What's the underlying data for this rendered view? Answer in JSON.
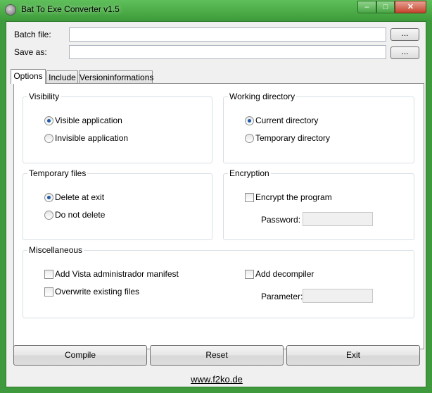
{
  "window": {
    "title": "Bat To Exe Converter v1.5",
    "controls": {
      "minimize": "‒",
      "maximize": "□",
      "close": "✕"
    }
  },
  "fields": {
    "batch_file": {
      "label": "Batch file:",
      "value": "",
      "browse": "..."
    },
    "save_as": {
      "label": "Save as:",
      "value": "",
      "browse": "..."
    }
  },
  "tabs": [
    {
      "label": "Options",
      "active": true
    },
    {
      "label": "Include",
      "active": false
    },
    {
      "label": "Versioninformations",
      "active": false
    }
  ],
  "visibility": {
    "title": "Visibility",
    "options": [
      {
        "label": "Visible application",
        "selected": true
      },
      {
        "label": "Invisible application",
        "selected": false
      }
    ]
  },
  "working_directory": {
    "title": "Working directory",
    "options": [
      {
        "label": "Current directory",
        "selected": true
      },
      {
        "label": "Temporary directory",
        "selected": false
      }
    ]
  },
  "temporary_files": {
    "title": "Temporary files",
    "options": [
      {
        "label": "Delete at exit",
        "selected": true
      },
      {
        "label": "Do not delete",
        "selected": false
      }
    ]
  },
  "encryption": {
    "title": "Encryption",
    "encrypt_label": "Encrypt the program",
    "encrypt_checked": false,
    "password_label": "Password:",
    "password_value": ""
  },
  "miscellaneous": {
    "title": "Miscellaneous",
    "vista_manifest": {
      "label": "Add Vista administrador manifest",
      "checked": false
    },
    "overwrite": {
      "label": "Overwrite existing files",
      "checked": false
    },
    "decompiler": {
      "label": "Add decompiler",
      "checked": false
    },
    "parameter_label": "Parameter:",
    "parameter_value": ""
  },
  "buttons": {
    "compile": "Compile",
    "reset": "Reset",
    "exit": "Exit"
  },
  "footer_link": "www.f2ko.de",
  "colors": {
    "window_frame": "#3e9a3c",
    "radio_dot": "#1d5aa8",
    "close_button": "#c4432d"
  }
}
